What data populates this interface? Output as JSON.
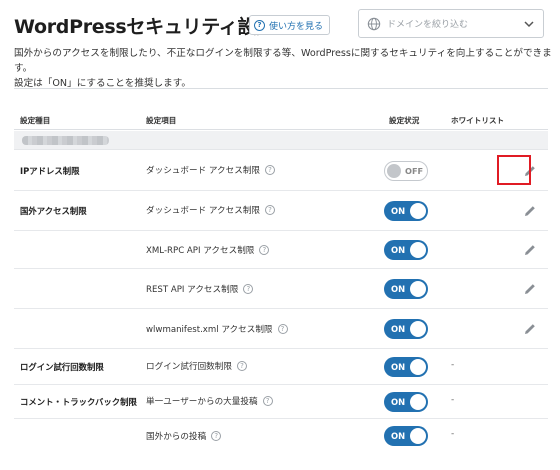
{
  "header": {
    "title": "WordPressセキュリティ設定",
    "help_label": "使い方を見る",
    "domain_placeholder": "ドメインを絞り込む"
  },
  "description": {
    "line1": "国外からのアクセスを制限したり、不正なログインを制限する等、WordPressに関するセキュリティを向上することができます。",
    "line2": "設定は「ON」にすることを推奨します。"
  },
  "table": {
    "columns": {
      "category": "設定種目",
      "item": "設定項目",
      "status": "設定状況",
      "whitelist": "ホワイトリスト"
    },
    "rows": [
      {
        "category": "IPアドレス制限",
        "item": "ダッシュボード アクセス制限",
        "status": "OFF",
        "whitelist": "edit"
      },
      {
        "category": "国外アクセス制限",
        "item": "ダッシュボード アクセス制限",
        "status": "ON",
        "whitelist": "edit"
      },
      {
        "category": "",
        "item": "XML-RPC API アクセス制限",
        "status": "ON",
        "whitelist": "edit"
      },
      {
        "category": "",
        "item": "REST API アクセス制限",
        "status": "ON",
        "whitelist": "edit"
      },
      {
        "category": "",
        "item": "wlwmanifest.xml アクセス制限",
        "status": "ON",
        "whitelist": "edit"
      },
      {
        "category": "ログイン試行回数制限",
        "item": "ログイン試行回数制限",
        "status": "ON",
        "whitelist": "-"
      },
      {
        "category": "コメント・トラックバック制限",
        "item": "単一ユーザーからの大量投稿",
        "status": "ON",
        "whitelist": "-"
      },
      {
        "category": "",
        "item": "国外からの投稿",
        "status": "ON",
        "whitelist": "-"
      }
    ]
  },
  "icons": {
    "help": "question-circle-icon",
    "domain": "globe-icon",
    "dropdown": "chevron-down-icon",
    "info": "question-circle-icon",
    "edit": "pencil-icon"
  },
  "colors": {
    "accent": "#2271b1",
    "highlight": "#e01b24"
  }
}
